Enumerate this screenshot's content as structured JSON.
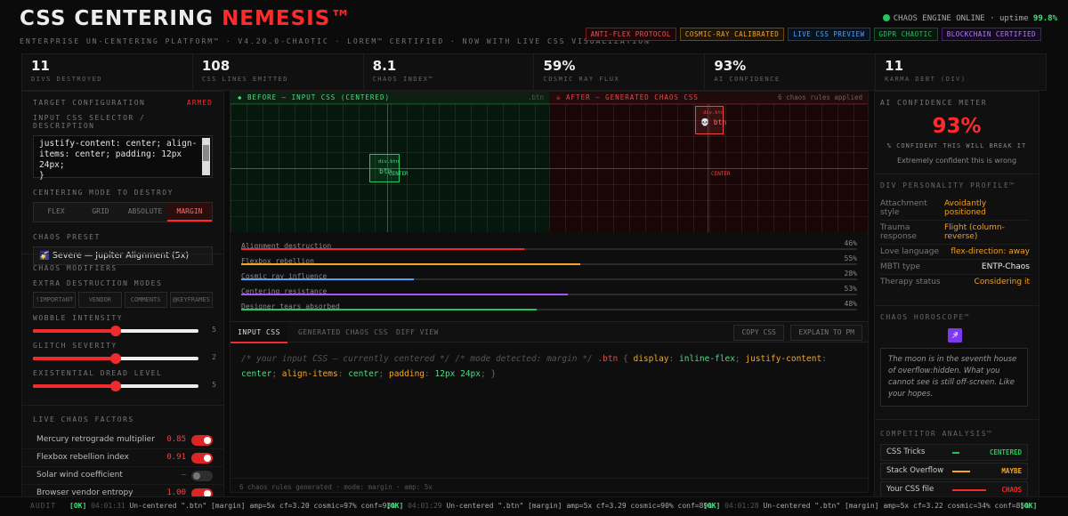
{
  "header": {
    "brand_main": "CSS CENTERING ",
    "brand_accent": "NEMESIS™",
    "tagline": "ENTERPRISE UN-CENTERING PLATFORM™ · V4.20.0-CHAOTIC · LOREM™ CERTIFIED · NOW WITH LIVE CSS VISUALIZATION",
    "status_text": "CHAOS ENGINE ONLINE · uptime ",
    "uptime": "99.8%",
    "badges": [
      {
        "label": "ANTI-FLEX PROTOCOL",
        "color": "#ff3b3b"
      },
      {
        "label": "COSMIC-RAY CALIBRATED",
        "color": "#f5a623"
      },
      {
        "label": "LIVE CSS PREVIEW",
        "color": "#4aa3ff"
      },
      {
        "label": "GDPR CHAOTIC",
        "color": "#22c55e"
      },
      {
        "label": "BLOCKCHAIN CERTIFIED",
        "color": "#a855f7"
      }
    ]
  },
  "stats": [
    {
      "value": "11",
      "label": "DIVS DESTROYED"
    },
    {
      "value": "108",
      "label": "CSS LINES EMITTED"
    },
    {
      "value": "8.1",
      "label": "CHAOS INDEX™"
    },
    {
      "value": "59%",
      "label": "COSMIC RAY FLUX"
    },
    {
      "value": "93%",
      "label": "AI CONFIDENCE"
    },
    {
      "value": "11",
      "label": "KARMA DEBT (DIV)"
    }
  ],
  "left": {
    "target_title": "TARGET CONFIGURATION",
    "armed": "ARMED",
    "input_label": "INPUT CSS SELECTOR / DESCRIPTION",
    "input_value": "justify-content: center; align-items: center; padding: 12px 24px;\n}",
    "mode_label": "CENTERING MODE TO DESTROY",
    "modes": [
      "FLEX",
      "GRID",
      "ABSOLUTE",
      "MARGIN"
    ],
    "active_mode": 3,
    "preset_label": "CHAOS PRESET",
    "preset_value": "🌠 Severe — Jupiter Alignment (5x)",
    "modifiers_title": "CHAOS MODIFIERS",
    "extra_label": "EXTRA DESTRUCTION MODES",
    "extra_modes": [
      "!IMPORTANT",
      "VENDOR",
      "COMMENTS",
      "@KEYFRAMES"
    ],
    "sliders": [
      {
        "label": "WOBBLE INTENSITY",
        "value": "5",
        "level": 0.5
      },
      {
        "label": "GLITCH SEVERITY",
        "value": "2",
        "level": 0.5
      },
      {
        "label": "EXISTENTIAL DREAD LEVEL",
        "value": "5",
        "level": 0.5
      }
    ],
    "factors_title": "LIVE CHAOS FACTORS",
    "factors": [
      {
        "label": "Mercury retrograde multiplier",
        "value": "0.85",
        "on": true
      },
      {
        "label": "Flexbox rebellion index",
        "value": "0.91",
        "on": true
      },
      {
        "label": "Solar wind coefficient",
        "value": "—",
        "on": false
      },
      {
        "label": "Browser vendor entropy",
        "value": "1.00",
        "on": true
      }
    ]
  },
  "center": {
    "before_title": "◆ BEFORE — INPUT CSS (CENTERED)",
    "before_selector": ".btn",
    "after_title": "☠ AFTER — GENERATED CHAOS CSS",
    "after_count": "6 chaos rules applied",
    "before_div_label": "div.btn",
    "before_btn": "btn",
    "before_center_label": "CENTER",
    "after_div_label": "div.btn",
    "after_btn": "💀 btn",
    "after_center_label": "CENTER",
    "bars": [
      {
        "label": "Alignment destruction",
        "pct": "46%",
        "value": 46,
        "color": "#ef2b2b"
      },
      {
        "label": "Flexbox rebellion",
        "pct": "55%",
        "value": 55,
        "color": "#f5a623"
      },
      {
        "label": "Cosmic ray influence",
        "pct": "28%",
        "value": 28,
        "color": "#4aa3ff"
      },
      {
        "label": "Centering resistance",
        "pct": "53%",
        "value": 53,
        "color": "#a855f7"
      },
      {
        "label": "Designer tears absorbed",
        "pct": "48%",
        "value": 48,
        "color": "#22c55e"
      }
    ],
    "tabs": [
      "INPUT CSS",
      "GENERATED CHAOS CSS",
      "DIFF VIEW"
    ],
    "copy_button": "COPY CSS",
    "explain_button": "EXPLAIN TO PM",
    "code_comment": "/* your input CSS — currently centered */ /* mode detected: margin */",
    "code_selector": ".btn",
    "code_decls": [
      {
        "prop": "display",
        "val": "inline-flex"
      },
      {
        "prop": "justify-content",
        "val": "center"
      },
      {
        "prop": "align-items",
        "val": "center"
      },
      {
        "prop": "padding",
        "val": "12px 24px"
      }
    ],
    "footer_note": "6 chaos rules generated · mode: margin · amp: 5x"
  },
  "right": {
    "ai_title": "AI CONFIDENCE METER",
    "ai_pct": "93%",
    "ai_sub": "% CONFIDENT THIS WILL BREAK IT",
    "ai_note": "Extremely confident this is wrong",
    "profile_title": "DIV PERSONALITY PROFILE™",
    "profile": [
      {
        "k": "Attachment style",
        "v": "Avoidantly positioned"
      },
      {
        "k": "Trauma response",
        "v": "Flight (column-reverse)"
      },
      {
        "k": "Love language",
        "v": "flex-direction: away"
      },
      {
        "k": "MBTI type",
        "v": "ENTP-Chaos"
      },
      {
        "k": "Therapy status",
        "v": "Considering it"
      }
    ],
    "horoscope_title": "CHAOS HOROSCOPE™",
    "horoscope_sign": "♐",
    "horoscope_text": "The moon is in the seventh house of overflow:hidden. What you cannot see is still off-screen. Like your hopes.",
    "competitor_title": "COMPETITOR ANALYSIS™",
    "competitors": [
      {
        "name": "CSS Tricks",
        "status": "CENTERED",
        "color": "#22c55e"
      },
      {
        "name": "Stack Overflow",
        "status": "MAYBE",
        "color": "#f5a623"
      },
      {
        "name": "Your CSS file",
        "status": "CHAOS",
        "color": "#ef2b2b"
      }
    ]
  },
  "audit": {
    "label": "AUDIT",
    "entries": [
      {
        "ok": "[OK]",
        "time": "04:01:31",
        "msg": "Un-centered \".btn\" [margin] amp=5x cf=3.20 cosmic=97% conf=93%"
      },
      {
        "ok": "[OK]",
        "time": "04:01:29",
        "msg": "Un-centered \".btn\" [margin] amp=5x cf=3.29 cosmic=90% conf=89%"
      },
      {
        "ok": "[OK]",
        "time": "04:01:28",
        "msg": "Un-centered \".btn\" [margin] amp=5x cf=3.22 cosmic=34% conf=85%"
      },
      {
        "ok": "[OK]",
        "time": "",
        "msg": ""
      }
    ]
  }
}
